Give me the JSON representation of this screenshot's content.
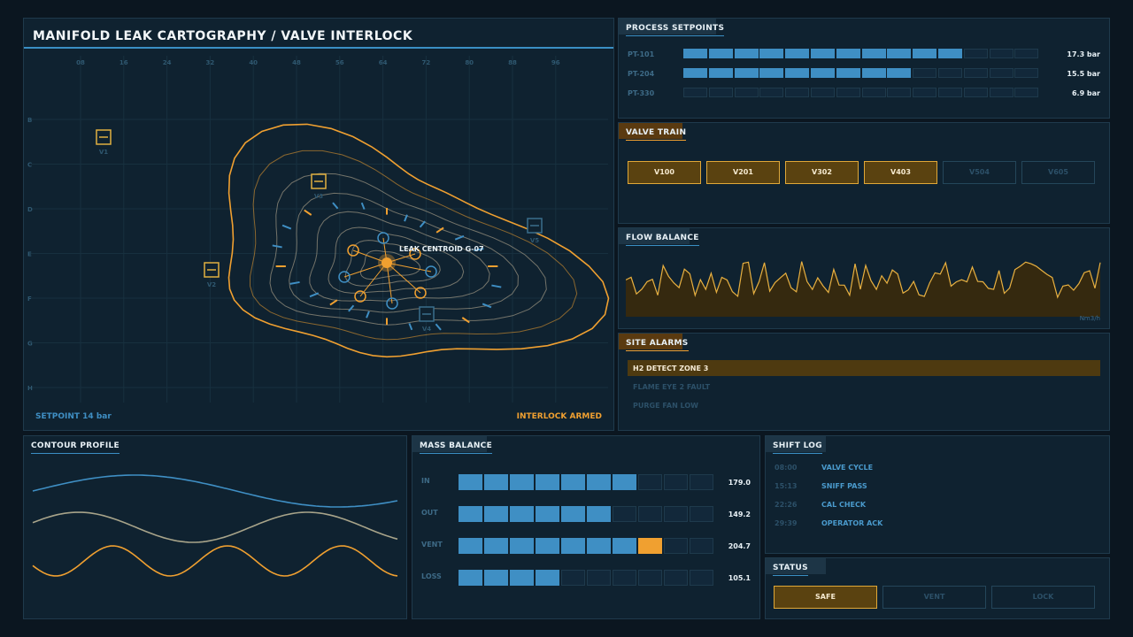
{
  "map": {
    "title": "MANIFOLD LEAK CARTOGRAPHY / VALVE INTERLOCK",
    "col_ticks": [
      "08",
      "16",
      "24",
      "32",
      "40",
      "48",
      "56",
      "64",
      "72",
      "80",
      "88",
      "96"
    ],
    "row_ticks": [
      "B",
      "C",
      "D",
      "E",
      "F",
      "G",
      "H"
    ],
    "valves": [
      "V1",
      "V2",
      "V3",
      "V4",
      "V5"
    ],
    "centroid_label": "LEAK CENTROID",
    "centroid_id": "G-07",
    "setpoint": "SETPOINT 14 bar",
    "interlock": "INTERLOCK ARMED"
  },
  "setpoints": {
    "title": "PROCESS SETPOINTS",
    "rows": [
      {
        "label": "PT-101",
        "value": "17.3 bar",
        "fill": 11,
        "total": 14
      },
      {
        "label": "PT-204",
        "value": "15.5 bar",
        "fill": 9,
        "total": 14
      },
      {
        "label": "PT-330",
        "value": "6.9 bar",
        "fill": 0,
        "total": 14
      }
    ]
  },
  "valve_train": {
    "title": "VALVE TRAIN",
    "valves": [
      {
        "label": "V100",
        "on": true
      },
      {
        "label": "V201",
        "on": true
      },
      {
        "label": "V302",
        "on": true
      },
      {
        "label": "V403",
        "on": true
      },
      {
        "label": "V504",
        "on": false
      },
      {
        "label": "V605",
        "on": false
      }
    ]
  },
  "flow": {
    "title": "FLOW BALANCE",
    "unit": "Nm3/h"
  },
  "alarms": {
    "title": "SITE ALARMS",
    "items": [
      {
        "label": "H2 DETECT ZONE 3",
        "active": true
      },
      {
        "label": "FLAME EYE 2 FAULT",
        "active": false
      },
      {
        "label": "PURGE FAN LOW",
        "active": false
      }
    ]
  },
  "contour": {
    "title": "CONTOUR PROFILE"
  },
  "mass": {
    "title": "MASS BALANCE",
    "rows": [
      {
        "label": "IN",
        "value": "179.0",
        "fill": 7,
        "alert": false
      },
      {
        "label": "OUT",
        "value": "149.2",
        "fill": 6,
        "alert": false
      },
      {
        "label": "VENT",
        "value": "204.7",
        "fill": 8,
        "alert": true
      },
      {
        "label": "LOSS",
        "value": "105.1",
        "fill": 4,
        "alert": false
      }
    ]
  },
  "shift_log": {
    "title": "SHIFT LOG",
    "entries": [
      {
        "time": "08:00",
        "event": "VALVE CYCLE"
      },
      {
        "time": "15:13",
        "event": "SNIFF PASS"
      },
      {
        "time": "22:26",
        "event": "CAL CHECK"
      },
      {
        "time": "29:39",
        "event": "OPERATOR ACK"
      }
    ]
  },
  "status": {
    "title": "STATUS",
    "buttons": [
      {
        "label": "SAFE",
        "on": true
      },
      {
        "label": "VENT",
        "on": false
      },
      {
        "label": "LOCK",
        "on": false
      }
    ]
  },
  "colors": {
    "accent_orange": "#f0a030",
    "accent_blue": "#3f8fc4",
    "bg": "#0b1620"
  }
}
